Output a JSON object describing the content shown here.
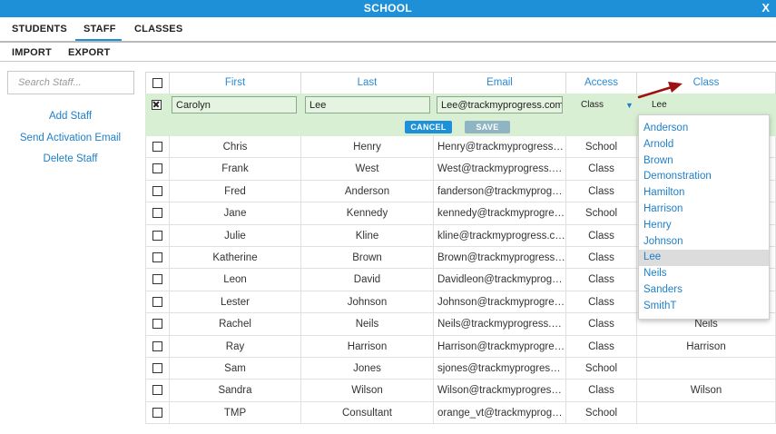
{
  "window": {
    "title": "SCHOOL",
    "close": "X"
  },
  "nav": {
    "students": "STUDENTS",
    "staff": "STAFF",
    "classes": "CLASSES"
  },
  "subnav": {
    "import": "IMPORT",
    "export": "EXPORT"
  },
  "sidebar": {
    "search_placeholder": "Search Staff...",
    "add_staff": "Add Staff",
    "send_activation": "Send Activation Email",
    "delete_staff": "Delete Staff"
  },
  "table": {
    "headers": {
      "first": "First",
      "last": "Last",
      "email": "Email",
      "access": "Access",
      "class": "Class"
    },
    "edit_row": {
      "first": "Carolyn",
      "last": "Lee",
      "email": "Lee@trackmyprogress.com",
      "access": "Class",
      "class": "Lee",
      "cancel": "CANCEL",
      "save": "SAVE"
    },
    "rows": [
      {
        "first": "Chris",
        "last": "Henry",
        "email": "Henry@trackmyprogress.com",
        "access": "School",
        "class": ""
      },
      {
        "first": "Frank",
        "last": "West",
        "email": "West@trackmyprogress.com",
        "access": "Class",
        "class": ""
      },
      {
        "first": "Fred",
        "last": "Anderson",
        "email": "fanderson@trackmyprogress.com",
        "access": "Class",
        "class": ""
      },
      {
        "first": "Jane",
        "last": "Kennedy",
        "email": "kennedy@trackmyprogress.com",
        "access": "School",
        "class": ""
      },
      {
        "first": "Julie",
        "last": "Kline",
        "email": "kline@trackmyprogress.com",
        "access": "Class",
        "class": ""
      },
      {
        "first": "Katherine",
        "last": "Brown",
        "email": "Brown@trackmyprogress.com",
        "access": "Class",
        "class": ""
      },
      {
        "first": "Leon",
        "last": "David",
        "email": "Davidleon@trackmyprogress.com",
        "access": "Class",
        "class": ""
      },
      {
        "first": "Lester",
        "last": "Johnson",
        "email": "Johnson@trackmyprogress.com",
        "access": "Class",
        "class": ""
      },
      {
        "first": "Rachel",
        "last": "Neils",
        "email": "Neils@trackmyprogress.com",
        "access": "Class",
        "class": "Neils"
      },
      {
        "first": "Ray",
        "last": "Harrison",
        "email": "Harrison@trackmyprogress.com",
        "access": "Class",
        "class": "Harrison"
      },
      {
        "first": "Sam",
        "last": "Jones",
        "email": "sjones@trackmyprogress.com",
        "access": "School",
        "class": ""
      },
      {
        "first": "Sandra",
        "last": "Wilson",
        "email": "Wilson@trackmyprogress.com",
        "access": "Class",
        "class": "Wilson"
      },
      {
        "first": "TMP",
        "last": "Consultant",
        "email": "orange_vt@trackmyprogress.com",
        "access": "School",
        "class": ""
      }
    ]
  },
  "class_dropdown": {
    "options": [
      "Anderson",
      "Arnold",
      "Brown",
      "Demonstration",
      "Hamilton",
      "Harrison",
      "Henry",
      "Johnson",
      "Lee",
      "Neils",
      "Sanders",
      "SmithT"
    ],
    "selected": "Lee"
  },
  "colors": {
    "accent": "#1e90d8",
    "edit_row": "#d9efd3",
    "arrow": "#a01010"
  },
  "icons": {
    "close": "close-icon",
    "checkbox": "checkbox-icon",
    "caret": "caret-down-icon",
    "arrow": "annotation-arrow-icon"
  }
}
